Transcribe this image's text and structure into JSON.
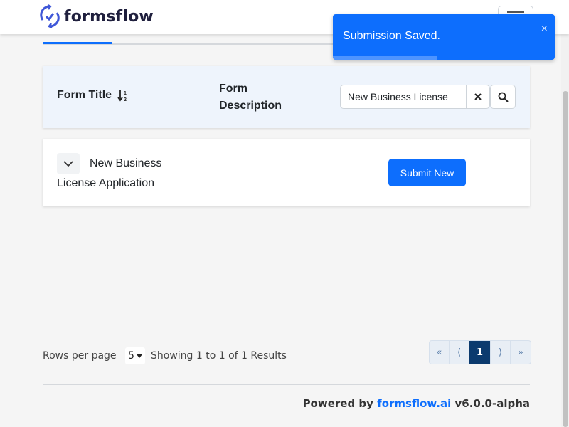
{
  "app": {
    "brand": "formsflow"
  },
  "tabs": [
    {
      "state": "active"
    }
  ],
  "table": {
    "headers": {
      "title": "Form Title",
      "description": "Form Description"
    },
    "search": {
      "value": "New Business License"
    },
    "rows": [
      {
        "title": "New Business License Application",
        "action": "Submit New"
      }
    ]
  },
  "pagination": {
    "rows_label": "Rows per page",
    "rows_per_page": "5",
    "summary": "Showing 1 to 1 of 1 Results",
    "buttons": {
      "first": "«",
      "prev": "⟨",
      "current": "1",
      "next": "⟩",
      "last": "»"
    }
  },
  "footer": {
    "powered_prefix": "Powered by",
    "link": "formsflow.ai",
    "version": "v6.0.0-alpha"
  },
  "toast": {
    "message": "Submission Saved.",
    "close": "×",
    "progress": 0.47
  },
  "colors": {
    "primary": "#0d6efd",
    "header_bg": "#eef4fc",
    "page_bg": "#f5f5f5",
    "pager_active": "#0b3a6e"
  },
  "icons": [
    "brand-logo-icon",
    "menu-icon",
    "sort-icon",
    "clear-icon",
    "search-icon",
    "chevron-down-icon",
    "caret-down-icon",
    "close-icon"
  ]
}
